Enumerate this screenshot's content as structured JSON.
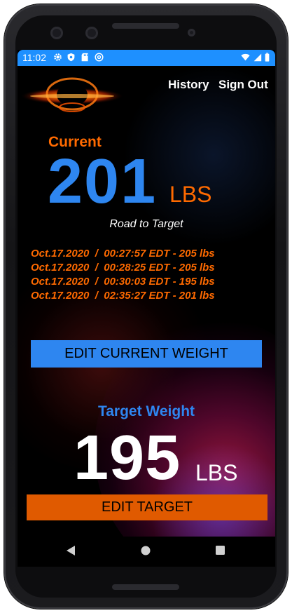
{
  "status_bar": {
    "time": "11:02",
    "left_icons": [
      "gear-icon",
      "shield-icon",
      "sd-card-icon",
      "at-sign-icon"
    ],
    "right_icons": [
      "wifi-icon",
      "signal-icon",
      "battery-icon"
    ]
  },
  "header": {
    "nav": [
      {
        "label": "History"
      },
      {
        "label": "Sign Out"
      }
    ]
  },
  "current": {
    "label": "Current",
    "value": "201",
    "unit": "LBS",
    "subtitle": "Road to Target",
    "history": [
      "Oct.17.2020  /  00:27:57 EDT - 205 lbs",
      "Oct.17.2020  /  00:28:25 EDT - 205 lbs",
      "Oct.17.2020  /  00:30:03 EDT - 195 lbs",
      "Oct.17.2020  /  02:35:27 EDT - 201 lbs"
    ],
    "edit_button": "EDIT CURRENT WEIGHT"
  },
  "target": {
    "label": "Target Weight",
    "value": "195",
    "unit": "LBS",
    "edit_button": "EDIT TARGET"
  },
  "system_nav": [
    "back-icon",
    "home-icon",
    "recents-icon"
  ],
  "colors": {
    "accent_blue": "#2e86f0",
    "accent_orange": "#ff6a00",
    "button_orange": "#e05a00",
    "statusbar_blue": "#1e90ff"
  }
}
